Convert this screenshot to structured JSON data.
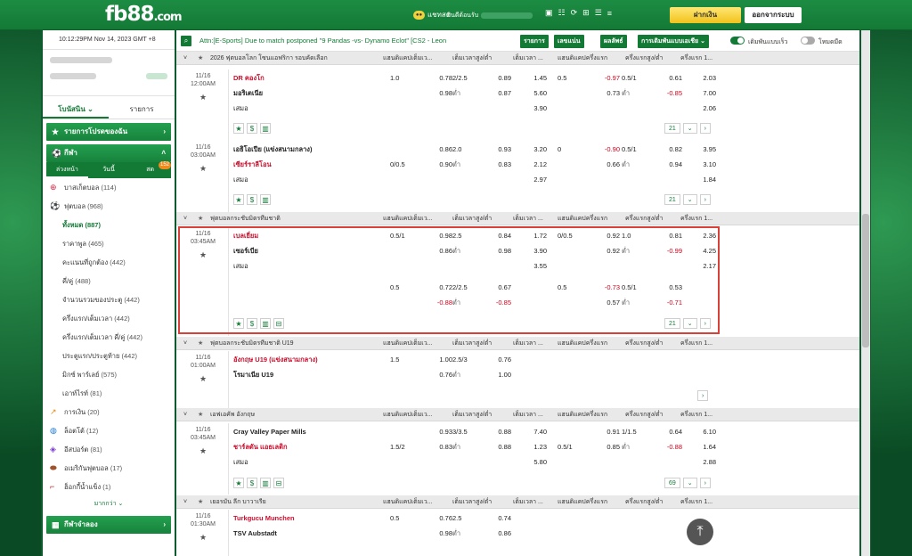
{
  "header": {
    "logo_main": "fb88",
    "logo_dom": ".com",
    "chat_label": "แชทสด",
    "chat_icon": "chat-bubble-icon",
    "welcome_label": "ยินดีต้อนรับ",
    "deposit_button": "ฝากเงิน",
    "logout_button": "ออกจากระบบ",
    "icons": [
      "cashier-icon",
      "account-icon",
      "24-7-icon",
      "gift-icon",
      "checklist-icon",
      "menu-icon"
    ]
  },
  "sidebar": {
    "clock": "10:12:29PM Nov 14, 2023 GMT +8",
    "tabs": [
      "โบนัสนิน",
      "รายการ"
    ],
    "my_list": "รายการโปรดของฉัน",
    "sports_title": "กีฬา",
    "subtabs": [
      "ล่วงหน้า",
      "วันนี้",
      "สด"
    ],
    "live_badge": "152",
    "items": [
      {
        "icon": "basketball-icon",
        "label": "บาสเก็ตบอล",
        "count": "(114)"
      },
      {
        "icon": "soccer-icon",
        "label": "ฟุตบอล",
        "count": "(968)"
      }
    ],
    "soccer_sub": [
      {
        "label": "ทั้งหมด",
        "count": "(887)"
      },
      {
        "label": "ราคาพูล",
        "count": "(465)"
      },
      {
        "label": "คะแนนที่ถูกต้อง",
        "count": "(442)"
      },
      {
        "label": "คี่/คู่",
        "count": "(488)"
      },
      {
        "label": "จำนวนรวมของประตู",
        "count": "(442)"
      },
      {
        "label": "ครึ่งแรก/เต็มเวลา",
        "count": "(442)"
      },
      {
        "label": "ครึ่งแรก/เต็มเวลา คี่/คู่",
        "count": "(442)"
      },
      {
        "label": "ประตูแรก/ประตูท้าย",
        "count": "(442)"
      },
      {
        "label": "มิกซ์ พาร์เลย์",
        "count": "(575)"
      },
      {
        "label": "เอาท์ไรท์",
        "count": "(81)"
      }
    ],
    "others": [
      {
        "icon": "finance-icon",
        "label": "การเงิน",
        "count": "(20)"
      },
      {
        "icon": "lotto-icon",
        "label": "ล็อตโต้",
        "count": "(12)"
      },
      {
        "icon": "esports-icon",
        "label": "อีสปอร์ต",
        "count": "(81)"
      },
      {
        "icon": "american-football-icon",
        "label": "อเมริกันฟุตบอล",
        "count": "(17)"
      },
      {
        "icon": "ice-hockey-icon",
        "label": "ฮ็อกกี้น้ำแข็ง",
        "count": "(1)"
      }
    ],
    "more": "มากกว่า",
    "virtual": "กีฬาจำลอง"
  },
  "main": {
    "marquee": "Attn:[E-Sports] Due to match postponed \"9 Pandas -vs- Dynamo Eclot\" [CS2 - Leon",
    "buttons": [
      "รายการ",
      "เลขแน่น",
      "ผลลัพธ์",
      "การเดิมพันแบบเอเชีย"
    ],
    "toggle1": "เดิมพันแบบเร็ว",
    "toggle2": "โหมดมืด",
    "col_headers": [
      "แฮนดิแคปเต็มเว...",
      "เต็มเวลาสูง/ต่ำ",
      "เต็มเวลา ...",
      "แฮนดิแคปครึ่งแรก",
      "ครึ่งแรกสูง/ต่ำ",
      "ครึ่งแรก 1..."
    ],
    "leagues": [
      {
        "name": "2026 ฟุตบอลโลก โซนแอฟริกา รอบคัดเลือก"
      },
      {
        "name": "ฟุตบอลกระชับมิตรทีมชาติ"
      },
      {
        "name": "ฟุตบอลกระชับมิตรทีมชาติ U19"
      },
      {
        "name": "เอฟเอคัพ อังกฤษ"
      },
      {
        "name": "เยอรมัน ลีก บาวาเรีย"
      }
    ],
    "matches": [
      {
        "date": "11/16",
        "time": "12:00AM",
        "home": "DR คองโก",
        "away": "มอริเตเนีย",
        "draw": "เสมอ",
        "r1": [
          "1.0",
          "0.78",
          "2/2.5",
          "0.89",
          "1.45",
          "0.5",
          "-0.97",
          "0.5/1",
          "0.61",
          "2.03"
        ],
        "r2": [
          "",
          "0.98",
          "ต่ำ",
          "0.87",
          "5.60",
          "",
          "0.73",
          "ต่ำ",
          "-0.85",
          "7.00"
        ],
        "r3": [
          "3.90",
          "2.06"
        ],
        "more": "21"
      },
      {
        "date": "11/16",
        "time": "03:00AM",
        "home": "เอธิโอเปีย (แข่งสนามกลาง)",
        "away": "เซียร์ราลีโอน",
        "draw": "เสมอ",
        "r1": [
          "",
          "0.86",
          "2.0",
          "0.93",
          "3.20",
          "0",
          "-0.90",
          "0.5/1",
          "0.82",
          "3.95"
        ],
        "r2": [
          "0/0.5",
          "0.90",
          "ต่ำ",
          "0.83",
          "2.12",
          "",
          "0.66",
          "ต่ำ",
          "0.94",
          "3.10"
        ],
        "r3": [
          "2.97",
          "1.84"
        ],
        "more": "21"
      },
      {
        "date": "11/16",
        "time": "03:45AM",
        "home": "เบลเยี่ยม",
        "away": "เซอร์เบีย",
        "draw": "เสมอ",
        "r1": [
          "0.5/1",
          "0.98",
          "2.5",
          "0.84",
          "1.72",
          "0/0.5",
          "0.92",
          "1.0",
          "0.81",
          "2.36"
        ],
        "r2": [
          "",
          "0.86",
          "ต่ำ",
          "0.98",
          "3.90",
          "",
          "0.92",
          "ต่ำ",
          "-0.99",
          "4.25"
        ],
        "r3": [
          "3.55",
          "2.17"
        ],
        "alt1": [
          "0.5",
          "0.72",
          "2/2.5",
          "0.67",
          "0.5",
          "-0.73",
          "0.5/1",
          "0.53"
        ],
        "alt2": [
          "",
          "-0.88",
          "ต่ำ",
          "-0.85",
          "",
          "0.57",
          "ต่ำ",
          "-0.71"
        ],
        "more": "21"
      },
      {
        "date": "11/16",
        "time": "01:00AM",
        "home": "อังกฤษ U19 (แข่งสนามกลาง)",
        "away": "โรมาเนีย U19",
        "r1": [
          "1.5",
          "1.00",
          "2.5/3",
          "0.76"
        ],
        "r2": [
          "",
          "0.76",
          "ต่ำ",
          "1.00"
        ]
      },
      {
        "date": "11/16",
        "time": "03:45AM",
        "home": "Cray Valley Paper Mills",
        "away": "ชาร์ลตัน แอธเลติก",
        "draw": "เสมอ",
        "r1": [
          "",
          "0.93",
          "3/3.5",
          "0.88",
          "7.40",
          "",
          "0.91",
          "1/1.5",
          "0.64",
          "6.10"
        ],
        "r2": [
          "1.5/2",
          "0.83",
          "ต่ำ",
          "0.88",
          "1.23",
          "0.5/1",
          "0.85",
          "ต่ำ",
          "-0.88",
          "1.64"
        ],
        "r3": [
          "5.80",
          "2.88"
        ],
        "more": "69"
      },
      {
        "date": "11/16",
        "time": "01:30AM",
        "home": "Turkgucu Munchen",
        "away": "TSV Aubstadt",
        "r1": [
          "0.5",
          "0.76",
          "2.5",
          "0.74"
        ],
        "r2": [
          "",
          "0.98",
          "ต่ำ",
          "0.86"
        ]
      }
    ]
  }
}
